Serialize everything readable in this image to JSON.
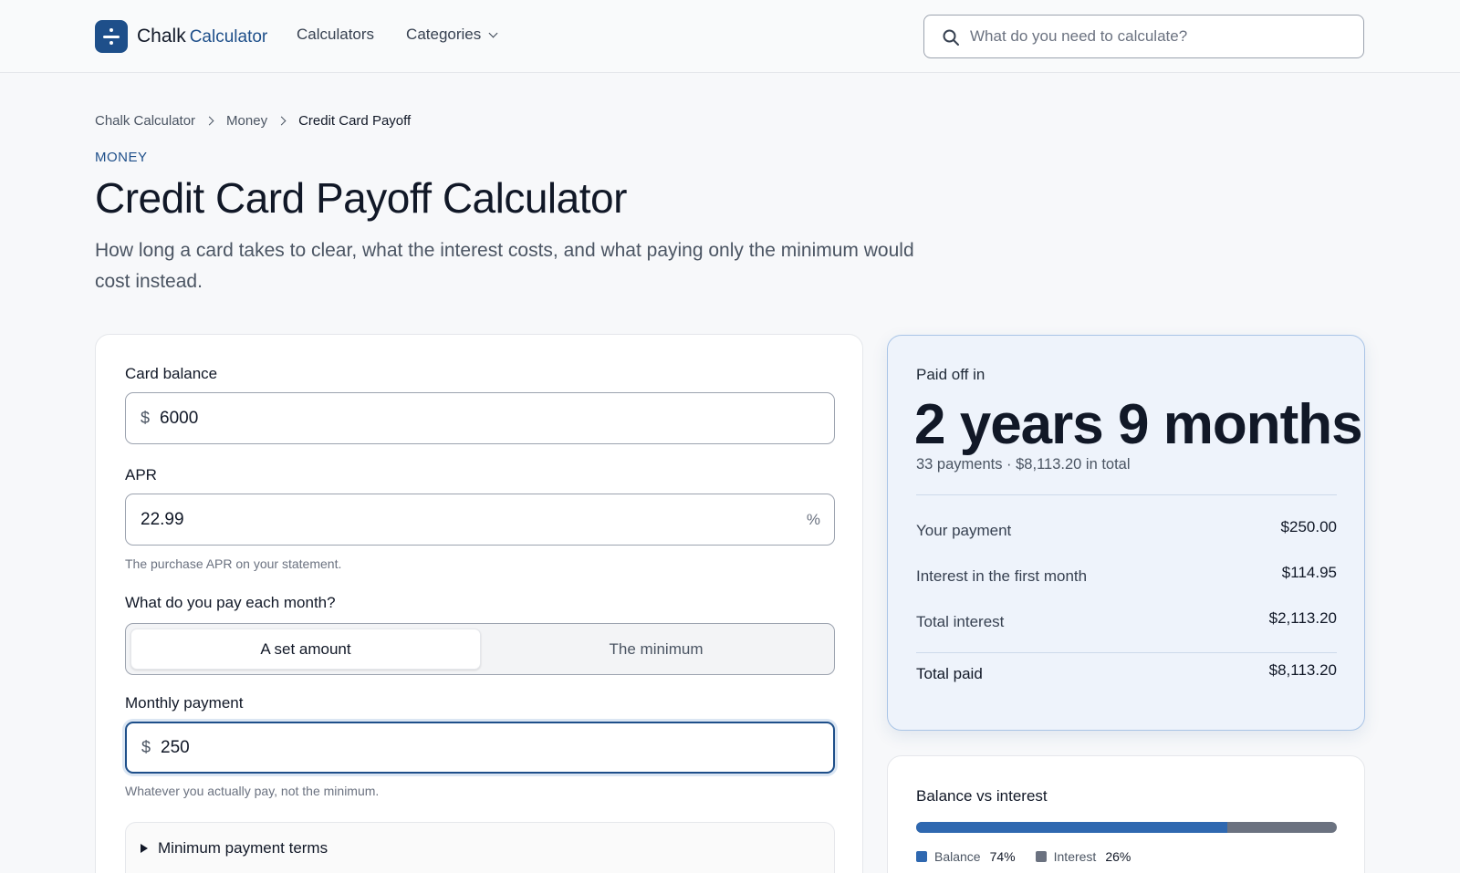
{
  "header": {
    "logo_name": "Chalk",
    "logo_sub": "Calculator",
    "nav": {
      "calculators": "Calculators",
      "categories": "Categories"
    },
    "search_placeholder": "What do you need to calculate?"
  },
  "breadcrumb": [
    "Chalk Calculator",
    "Money",
    "Credit Card Payoff"
  ],
  "eyebrow": "MONEY",
  "title": "Credit Card Payoff Calculator",
  "lede": "How long a card takes to clear, what the interest costs, and what paying only the minimum would cost instead.",
  "form": {
    "balance_label": "Card balance",
    "balance_prefix": "$",
    "balance_value": "6000",
    "apr_label": "APR",
    "apr_value": "22.99",
    "apr_suffix": "%",
    "apr_hint": "The purchase APR on your statement.",
    "pay_label": "What do you pay each month?",
    "pay_options": [
      "A set amount",
      "The minimum"
    ],
    "pay_selected": "A set amount",
    "monthly_label": "Monthly payment",
    "monthly_prefix": "$",
    "monthly_value": "250",
    "monthly_hint": "Whatever you actually pay, not the minimum.",
    "details_label": "Minimum payment terms"
  },
  "result": {
    "label": "Paid off in",
    "headline": "2 years 9 months",
    "subline": "33 payments · $8,113.20 in total",
    "rows": [
      {
        "label": "Your payment",
        "value": "$250.00"
      },
      {
        "label": "Interest in the first month",
        "value": "$114.95"
      },
      {
        "label": "Total interest",
        "value": "$2,113.20"
      },
      {
        "label": "Total paid",
        "value": "$8,113.20"
      }
    ]
  },
  "balance_vs_interest": {
    "title": "Balance vs interest",
    "balance_label": "Balance",
    "balance_pct": "74%",
    "balance_fraction": 0.74,
    "interest_label": "Interest",
    "interest_pct": "26%",
    "colors": {
      "balance": "#2f68b0",
      "interest": "#6b7280"
    }
  },
  "colors": {
    "brand": "#1e4f8a",
    "result_bg": "#eef3fb"
  }
}
